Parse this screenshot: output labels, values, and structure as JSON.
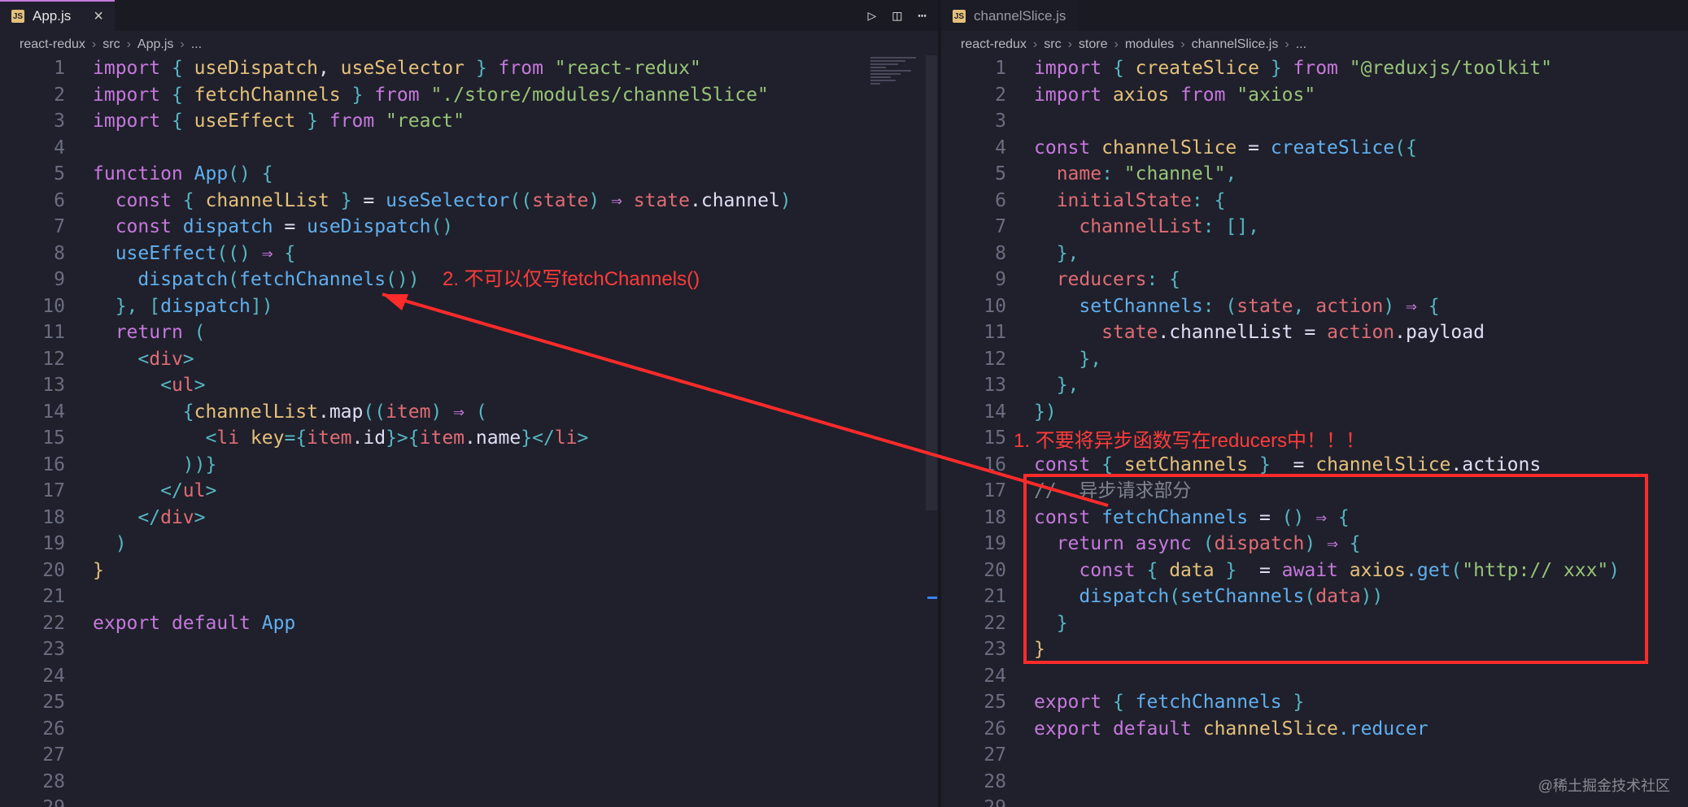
{
  "left": {
    "tab": {
      "icon": "JS",
      "name": "App.js"
    },
    "breadcrumb": [
      "react-redux",
      "src",
      "App.js",
      "..."
    ],
    "lines": [
      {
        "n": "1",
        "seg": [
          [
            "kw",
            "import"
          ],
          [
            "pun",
            " { "
          ],
          [
            "var",
            "useDispatch"
          ],
          [
            "",
            ","
          ],
          [
            "var",
            " useSelector"
          ],
          [
            "pun",
            " } "
          ],
          [
            "kw",
            "from"
          ],
          [
            "str",
            " \"react-redux\""
          ]
        ]
      },
      {
        "n": "2",
        "seg": [
          [
            "kw",
            "import"
          ],
          [
            "pun",
            " { "
          ],
          [
            "var",
            "fetchChannels"
          ],
          [
            "pun",
            " } "
          ],
          [
            "kw",
            "from"
          ],
          [
            "str",
            " \"./store/modules/channelSlice\""
          ]
        ]
      },
      {
        "n": "3",
        "seg": [
          [
            "kw",
            "import"
          ],
          [
            "pun",
            " { "
          ],
          [
            "var",
            "useEffect"
          ],
          [
            "pun",
            " } "
          ],
          [
            "kw",
            "from"
          ],
          [
            "str",
            " \"react\""
          ]
        ]
      },
      {
        "n": "4",
        "seg": []
      },
      {
        "n": "5",
        "seg": [
          [
            "kw",
            "function"
          ],
          [
            "fn",
            " App"
          ],
          [
            "pun",
            "() {"
          ]
        ]
      },
      {
        "n": "6",
        "seg": [
          [
            "",
            "  "
          ],
          [
            "kw",
            "const"
          ],
          [
            "pun",
            " { "
          ],
          [
            "var",
            "channelList"
          ],
          [
            "pun",
            " } "
          ],
          [
            "",
            "= "
          ],
          [
            "fn",
            "useSelector"
          ],
          [
            "pun",
            "(("
          ],
          [
            "prop",
            "state"
          ],
          [
            "pun",
            ") "
          ],
          [
            "kw",
            "⇒"
          ],
          [
            "prop",
            " state"
          ],
          [
            "",
            ".channel"
          ],
          [
            "pun",
            ")"
          ]
        ]
      },
      {
        "n": "7",
        "seg": [
          [
            "",
            "  "
          ],
          [
            "kw",
            "const"
          ],
          [
            "fn",
            " dispatch"
          ],
          [
            "",
            " = "
          ],
          [
            "fn",
            "useDispatch"
          ],
          [
            "pun",
            "()"
          ]
        ]
      },
      {
        "n": "8",
        "seg": [
          [
            "",
            "  "
          ],
          [
            "fn",
            "useEffect"
          ],
          [
            "pun",
            "(() "
          ],
          [
            "kw",
            "⇒"
          ],
          [
            "pun",
            " {"
          ]
        ]
      },
      {
        "n": "9",
        "seg": [
          [
            "",
            "    "
          ],
          [
            "fn",
            "dispatch"
          ],
          [
            "pun",
            "("
          ],
          [
            "fn",
            "fetchChannels"
          ],
          [
            "pun",
            "())"
          ]
        ]
      },
      {
        "n": "10",
        "seg": [
          [
            "",
            "  "
          ],
          [
            "pun",
            "}, ["
          ],
          [
            "fn",
            "dispatch"
          ],
          [
            "pun",
            "])"
          ]
        ]
      },
      {
        "n": "11",
        "seg": [
          [
            "",
            "  "
          ],
          [
            "kw",
            "return"
          ],
          [
            "pun",
            " ("
          ]
        ]
      },
      {
        "n": "12",
        "seg": [
          [
            "",
            "    "
          ],
          [
            "pun",
            "<"
          ],
          [
            "tag",
            "div"
          ],
          [
            "pun",
            ">"
          ]
        ]
      },
      {
        "n": "13",
        "seg": [
          [
            "",
            "      "
          ],
          [
            "pun",
            "<"
          ],
          [
            "tag",
            "ul"
          ],
          [
            "pun",
            ">"
          ]
        ]
      },
      {
        "n": "14",
        "seg": [
          [
            "",
            "        "
          ],
          [
            "pun",
            "{"
          ],
          [
            "var",
            "channelList"
          ],
          [
            "",
            ".map"
          ],
          [
            "pun",
            "(("
          ],
          [
            "prop",
            "item"
          ],
          [
            "pun",
            ") "
          ],
          [
            "kw",
            "⇒"
          ],
          [
            "pun",
            " ("
          ]
        ]
      },
      {
        "n": "15",
        "seg": [
          [
            "",
            "          "
          ],
          [
            "pun",
            "<"
          ],
          [
            "tag",
            "li"
          ],
          [
            "var",
            " key"
          ],
          [
            "pun",
            "={"
          ],
          [
            "prop",
            "item"
          ],
          [
            "",
            ".id"
          ],
          [
            "pun",
            "}>{"
          ],
          [
            "prop",
            "item"
          ],
          [
            "",
            ".name"
          ],
          [
            "pun",
            "}</"
          ],
          [
            "tag",
            "li"
          ],
          [
            "pun",
            ">"
          ]
        ]
      },
      {
        "n": "16",
        "seg": [
          [
            "",
            "        "
          ],
          [
            "pun",
            "))}"
          ]
        ]
      },
      {
        "n": "17",
        "seg": [
          [
            "",
            "      "
          ],
          [
            "pun",
            "</"
          ],
          [
            "tag",
            "ul"
          ],
          [
            "pun",
            ">"
          ]
        ]
      },
      {
        "n": "18",
        "seg": [
          [
            "",
            "    "
          ],
          [
            "pun",
            "</"
          ],
          [
            "tag",
            "div"
          ],
          [
            "pun",
            ">"
          ]
        ]
      },
      {
        "n": "19",
        "seg": [
          [
            "",
            "  "
          ],
          [
            "pun",
            ")"
          ]
        ]
      },
      {
        "n": "20",
        "seg": [
          [
            "var",
            "}"
          ]
        ]
      },
      {
        "n": "21",
        "seg": []
      },
      {
        "n": "22",
        "seg": [
          [
            "kw",
            "export"
          ],
          [
            "kw",
            " default"
          ],
          [
            "fn",
            " App"
          ]
        ]
      },
      {
        "n": "23",
        "seg": []
      },
      {
        "n": "24",
        "seg": []
      },
      {
        "n": "25",
        "seg": []
      },
      {
        "n": "26",
        "seg": []
      },
      {
        "n": "27",
        "seg": []
      },
      {
        "n": "28",
        "seg": []
      },
      {
        "n": "29",
        "seg": []
      }
    ]
  },
  "right": {
    "tab": {
      "icon": "JS",
      "name": "channelSlice.js"
    },
    "breadcrumb": [
      "react-redux",
      "src",
      "store",
      "modules",
      "channelSlice.js",
      "..."
    ],
    "lines": [
      {
        "n": "1",
        "seg": [
          [
            "kw",
            "import"
          ],
          [
            "pun",
            " { "
          ],
          [
            "var",
            "createSlice"
          ],
          [
            "pun",
            " } "
          ],
          [
            "kw",
            "from"
          ],
          [
            "str",
            " \"@reduxjs/toolkit\""
          ]
        ]
      },
      {
        "n": "2",
        "seg": [
          [
            "kw",
            "import"
          ],
          [
            "var",
            " axios"
          ],
          [
            "kw",
            " from"
          ],
          [
            "str",
            " \"axios\""
          ]
        ]
      },
      {
        "n": "3",
        "seg": []
      },
      {
        "n": "4",
        "seg": [
          [
            "kw",
            "const"
          ],
          [
            "var",
            " channelSlice"
          ],
          [
            "",
            " = "
          ],
          [
            "fn",
            "createSlice"
          ],
          [
            "pun",
            "({"
          ]
        ]
      },
      {
        "n": "5",
        "seg": [
          [
            "",
            "  "
          ],
          [
            "prop",
            "name"
          ],
          [
            "pun",
            ": "
          ],
          [
            "str",
            "\"channel\""
          ],
          [
            "pun",
            ","
          ]
        ]
      },
      {
        "n": "6",
        "seg": [
          [
            "",
            "  "
          ],
          [
            "prop",
            "initialState"
          ],
          [
            "pun",
            ": {"
          ]
        ]
      },
      {
        "n": "7",
        "seg": [
          [
            "",
            "    "
          ],
          [
            "prop",
            "channelList"
          ],
          [
            "pun",
            ": [],"
          ]
        ]
      },
      {
        "n": "8",
        "seg": [
          [
            "",
            "  "
          ],
          [
            "pun",
            "},"
          ]
        ]
      },
      {
        "n": "9",
        "seg": [
          [
            "",
            "  "
          ],
          [
            "prop",
            "reducers"
          ],
          [
            "pun",
            ": {"
          ]
        ]
      },
      {
        "n": "10",
        "seg": [
          [
            "",
            "    "
          ],
          [
            "fn",
            "setChannels"
          ],
          [
            "pun",
            ": ("
          ],
          [
            "prop",
            "state"
          ],
          [
            "pun",
            ", "
          ],
          [
            "prop",
            "action"
          ],
          [
            "pun",
            ") "
          ],
          [
            "kw",
            "⇒"
          ],
          [
            "pun",
            " {"
          ]
        ]
      },
      {
        "n": "11",
        "seg": [
          [
            "",
            "      "
          ],
          [
            "prop",
            "state"
          ],
          [
            "",
            ".channelList"
          ],
          [
            "",
            " = "
          ],
          [
            "prop",
            "action"
          ],
          [
            "",
            ".payload"
          ]
        ]
      },
      {
        "n": "12",
        "seg": [
          [
            "",
            "    "
          ],
          [
            "pun",
            "},"
          ]
        ]
      },
      {
        "n": "13",
        "seg": [
          [
            "",
            "  "
          ],
          [
            "pun",
            "},"
          ]
        ]
      },
      {
        "n": "14",
        "seg": [
          [
            "pun",
            "})"
          ]
        ]
      },
      {
        "n": "15",
        "seg": []
      },
      {
        "n": "16",
        "seg": [
          [
            "kw",
            "const"
          ],
          [
            "pun",
            " { "
          ],
          [
            "var",
            "setChannels"
          ],
          [
            "pun",
            " } "
          ],
          [
            "",
            " = "
          ],
          [
            "var",
            "channelSlice"
          ],
          [
            "",
            ".actions"
          ]
        ]
      },
      {
        "n": "17",
        "seg": [
          [
            "cm",
            "//  异步请求部分"
          ]
        ]
      },
      {
        "n": "18",
        "seg": [
          [
            "kw",
            "const"
          ],
          [
            "fn",
            " fetchChannels"
          ],
          [
            "",
            " = "
          ],
          [
            "pun",
            "() "
          ],
          [
            "kw",
            "⇒"
          ],
          [
            "pun",
            " {"
          ]
        ]
      },
      {
        "n": "19",
        "seg": [
          [
            "",
            "  "
          ],
          [
            "kw",
            "return"
          ],
          [
            "kw",
            " async"
          ],
          [
            "pun",
            " ("
          ],
          [
            "prop",
            "dispatch"
          ],
          [
            "pun",
            ") "
          ],
          [
            "kw",
            "⇒"
          ],
          [
            "pun",
            " {"
          ]
        ]
      },
      {
        "n": "20",
        "seg": [
          [
            "",
            "    "
          ],
          [
            "kw",
            "const"
          ],
          [
            "pun",
            " { "
          ],
          [
            "var",
            "data"
          ],
          [
            "pun",
            " } "
          ],
          [
            "",
            " = "
          ],
          [
            "kw",
            "await"
          ],
          [
            "var",
            " axios"
          ],
          [
            "fn",
            ".get"
          ],
          [
            "pun",
            "("
          ],
          [
            "str",
            "\"http:// xxx\""
          ],
          [
            "pun",
            ")"
          ]
        ]
      },
      {
        "n": "21",
        "seg": [
          [
            "",
            "    "
          ],
          [
            "fn",
            "dispatch"
          ],
          [
            "pun",
            "("
          ],
          [
            "fn",
            "setChannels"
          ],
          [
            "pun",
            "("
          ],
          [
            "prop",
            "data"
          ],
          [
            "pun",
            "))"
          ]
        ]
      },
      {
        "n": "22",
        "seg": [
          [
            "",
            "  "
          ],
          [
            "pun",
            "}"
          ]
        ]
      },
      {
        "n": "23",
        "seg": [
          [
            "var",
            "}"
          ]
        ]
      },
      {
        "n": "24",
        "seg": []
      },
      {
        "n": "25",
        "seg": [
          [
            "kw",
            "export"
          ],
          [
            "pun",
            " { "
          ],
          [
            "fn",
            "fetchChannels"
          ],
          [
            "pun",
            " }"
          ]
        ]
      },
      {
        "n": "26",
        "seg": [
          [
            "kw",
            "export"
          ],
          [
            "kw",
            " default"
          ],
          [
            "var",
            " channelSlice"
          ],
          [
            "fn",
            ".reducer"
          ]
        ]
      },
      {
        "n": "27",
        "seg": []
      },
      {
        "n": "28",
        "seg": []
      },
      {
        "n": "29",
        "seg": []
      }
    ]
  },
  "annotations": {
    "note2": "2. 不可以仅写fetchChannels()",
    "note1": "1. 不要将异步函数写在reducers中！！！"
  },
  "toolbar": {
    "run_icon": "run-icon",
    "split_icon": "split-editor-icon",
    "more_icon": "more-icon"
  },
  "watermark": "@稀土掘金技术社区",
  "colors": {
    "accent": "#c678dd",
    "annotation": "#ff2b2b",
    "background": "#1f202b"
  }
}
